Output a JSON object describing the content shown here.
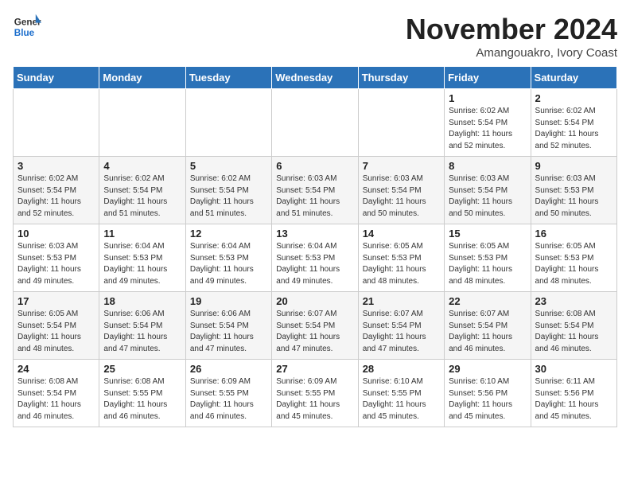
{
  "header": {
    "logo_line1": "General",
    "logo_line2": "Blue",
    "month_title": "November 2024",
    "location": "Amangouakro, Ivory Coast"
  },
  "weekdays": [
    "Sunday",
    "Monday",
    "Tuesday",
    "Wednesday",
    "Thursday",
    "Friday",
    "Saturday"
  ],
  "weeks": [
    [
      {
        "day": "",
        "info": ""
      },
      {
        "day": "",
        "info": ""
      },
      {
        "day": "",
        "info": ""
      },
      {
        "day": "",
        "info": ""
      },
      {
        "day": "",
        "info": ""
      },
      {
        "day": "1",
        "info": "Sunrise: 6:02 AM\nSunset: 5:54 PM\nDaylight: 11 hours\nand 52 minutes."
      },
      {
        "day": "2",
        "info": "Sunrise: 6:02 AM\nSunset: 5:54 PM\nDaylight: 11 hours\nand 52 minutes."
      }
    ],
    [
      {
        "day": "3",
        "info": "Sunrise: 6:02 AM\nSunset: 5:54 PM\nDaylight: 11 hours\nand 52 minutes."
      },
      {
        "day": "4",
        "info": "Sunrise: 6:02 AM\nSunset: 5:54 PM\nDaylight: 11 hours\nand 51 minutes."
      },
      {
        "day": "5",
        "info": "Sunrise: 6:02 AM\nSunset: 5:54 PM\nDaylight: 11 hours\nand 51 minutes."
      },
      {
        "day": "6",
        "info": "Sunrise: 6:03 AM\nSunset: 5:54 PM\nDaylight: 11 hours\nand 51 minutes."
      },
      {
        "day": "7",
        "info": "Sunrise: 6:03 AM\nSunset: 5:54 PM\nDaylight: 11 hours\nand 50 minutes."
      },
      {
        "day": "8",
        "info": "Sunrise: 6:03 AM\nSunset: 5:54 PM\nDaylight: 11 hours\nand 50 minutes."
      },
      {
        "day": "9",
        "info": "Sunrise: 6:03 AM\nSunset: 5:53 PM\nDaylight: 11 hours\nand 50 minutes."
      }
    ],
    [
      {
        "day": "10",
        "info": "Sunrise: 6:03 AM\nSunset: 5:53 PM\nDaylight: 11 hours\nand 49 minutes."
      },
      {
        "day": "11",
        "info": "Sunrise: 6:04 AM\nSunset: 5:53 PM\nDaylight: 11 hours\nand 49 minutes."
      },
      {
        "day": "12",
        "info": "Sunrise: 6:04 AM\nSunset: 5:53 PM\nDaylight: 11 hours\nand 49 minutes."
      },
      {
        "day": "13",
        "info": "Sunrise: 6:04 AM\nSunset: 5:53 PM\nDaylight: 11 hours\nand 49 minutes."
      },
      {
        "day": "14",
        "info": "Sunrise: 6:05 AM\nSunset: 5:53 PM\nDaylight: 11 hours\nand 48 minutes."
      },
      {
        "day": "15",
        "info": "Sunrise: 6:05 AM\nSunset: 5:53 PM\nDaylight: 11 hours\nand 48 minutes."
      },
      {
        "day": "16",
        "info": "Sunrise: 6:05 AM\nSunset: 5:53 PM\nDaylight: 11 hours\nand 48 minutes."
      }
    ],
    [
      {
        "day": "17",
        "info": "Sunrise: 6:05 AM\nSunset: 5:54 PM\nDaylight: 11 hours\nand 48 minutes."
      },
      {
        "day": "18",
        "info": "Sunrise: 6:06 AM\nSunset: 5:54 PM\nDaylight: 11 hours\nand 47 minutes."
      },
      {
        "day": "19",
        "info": "Sunrise: 6:06 AM\nSunset: 5:54 PM\nDaylight: 11 hours\nand 47 minutes."
      },
      {
        "day": "20",
        "info": "Sunrise: 6:07 AM\nSunset: 5:54 PM\nDaylight: 11 hours\nand 47 minutes."
      },
      {
        "day": "21",
        "info": "Sunrise: 6:07 AM\nSunset: 5:54 PM\nDaylight: 11 hours\nand 47 minutes."
      },
      {
        "day": "22",
        "info": "Sunrise: 6:07 AM\nSunset: 5:54 PM\nDaylight: 11 hours\nand 46 minutes."
      },
      {
        "day": "23",
        "info": "Sunrise: 6:08 AM\nSunset: 5:54 PM\nDaylight: 11 hours\nand 46 minutes."
      }
    ],
    [
      {
        "day": "24",
        "info": "Sunrise: 6:08 AM\nSunset: 5:54 PM\nDaylight: 11 hours\nand 46 minutes."
      },
      {
        "day": "25",
        "info": "Sunrise: 6:08 AM\nSunset: 5:55 PM\nDaylight: 11 hours\nand 46 minutes."
      },
      {
        "day": "26",
        "info": "Sunrise: 6:09 AM\nSunset: 5:55 PM\nDaylight: 11 hours\nand 46 minutes."
      },
      {
        "day": "27",
        "info": "Sunrise: 6:09 AM\nSunset: 5:55 PM\nDaylight: 11 hours\nand 45 minutes."
      },
      {
        "day": "28",
        "info": "Sunrise: 6:10 AM\nSunset: 5:55 PM\nDaylight: 11 hours\nand 45 minutes."
      },
      {
        "day": "29",
        "info": "Sunrise: 6:10 AM\nSunset: 5:56 PM\nDaylight: 11 hours\nand 45 minutes."
      },
      {
        "day": "30",
        "info": "Sunrise: 6:11 AM\nSunset: 5:56 PM\nDaylight: 11 hours\nand 45 minutes."
      }
    ]
  ]
}
